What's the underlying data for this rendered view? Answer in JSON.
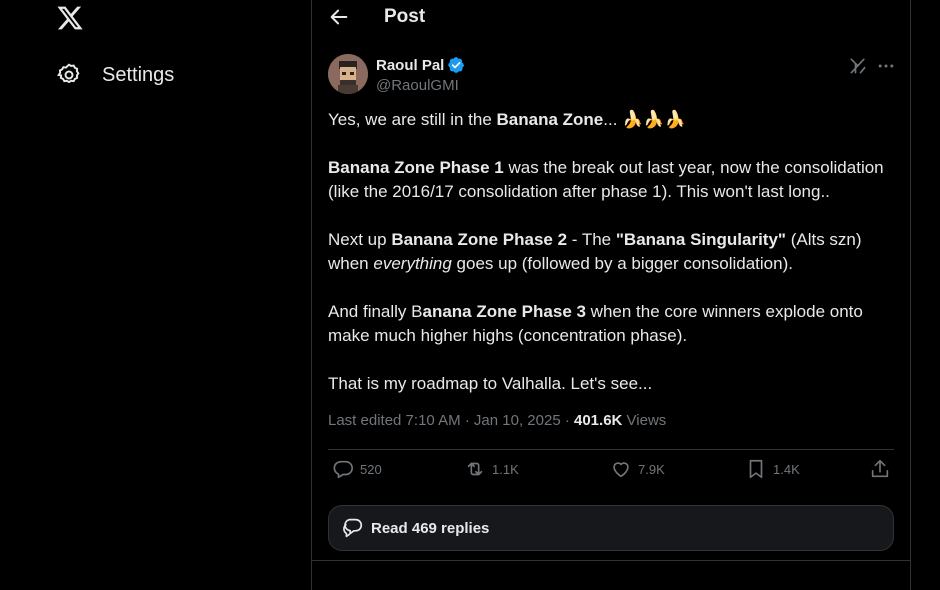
{
  "left_nav": {
    "settings_label": "Settings"
  },
  "header": {
    "title": "Post"
  },
  "tweet": {
    "author_name": "Raoul Pal",
    "author_handle": "@RaoulGMI",
    "paragraphs": [
      [
        {
          "t": "Yes, we are still in the "
        },
        {
          "t": "Banana Zone",
          "b": true
        },
        {
          "t": "... 🍌🍌🍌"
        }
      ],
      [
        {
          "t": "Banana Zone Phase 1",
          "b": true
        },
        {
          "t": " was the break out last year, now the consolidation (like the 2016/17 consolidation after phase 1). This won't last long.."
        }
      ],
      [
        {
          "t": "Next up "
        },
        {
          "t": "Banana Zone Phase 2",
          "b": true
        },
        {
          "t": " - The "
        },
        {
          "t": "\"Banana Singularity\"",
          "b": true
        },
        {
          "t": " (Alts szn) when "
        },
        {
          "t": "everything",
          "i": true
        },
        {
          "t": " goes up (followed by a bigger consolidation)."
        }
      ],
      [
        {
          "t": "And finally B"
        },
        {
          "t": "anana Zone Phase 3",
          "b": true
        },
        {
          "t": " when the core winners explode onto make much higher highs (concentration phase)."
        }
      ],
      [
        {
          "t": "That is my roadmap to Valhalla. Let's see..."
        }
      ]
    ],
    "edited_label": "Last edited 7:10 AM · Jan 10, 2025 · ",
    "views_count": "401.6K",
    "views_label": " Views"
  },
  "actions": {
    "replies": "520",
    "reposts": "1.1K",
    "likes": "7.9K",
    "bookmarks": "1.4K"
  },
  "read_replies_label": "Read 469 replies",
  "colors": {
    "background": "#000000",
    "text": "#e7e9ea",
    "muted": "#71767b",
    "border": "#2f3336",
    "verified_blue": "#1d9bf0"
  },
  "icons": [
    "x-logo-icon",
    "gear-icon",
    "back-arrow-icon",
    "verified-badge-icon",
    "grok-icon",
    "more-icon",
    "reply-icon",
    "repost-icon",
    "like-icon",
    "bookmark-icon",
    "share-icon",
    "replies-bubble-icon"
  ]
}
